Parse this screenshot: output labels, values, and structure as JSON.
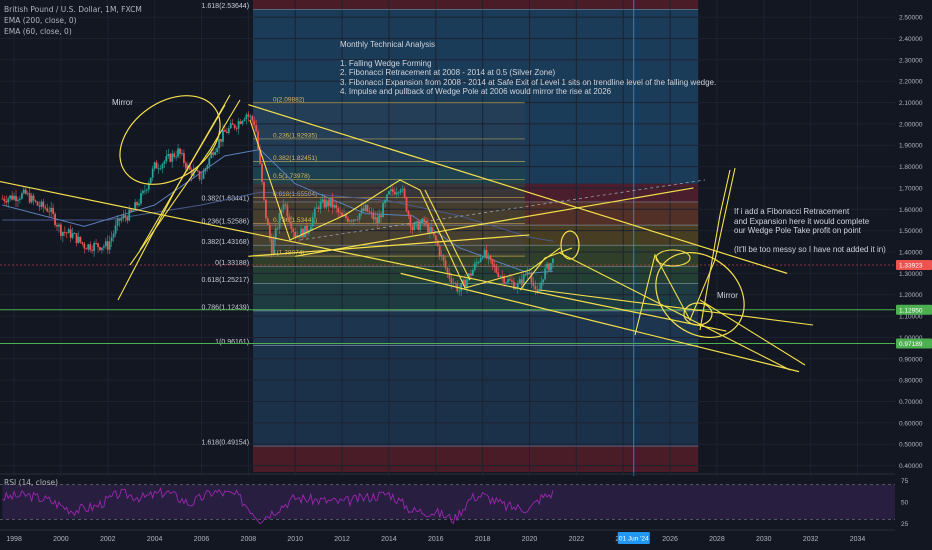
{
  "legend": {
    "symbol": "British Pound / U.S. Dollar, 1M, FXCM",
    "ema200": "EMA (200, close, 0)",
    "ema60": "EMA (60, close, 0)"
  },
  "analysis_text": {
    "title": "Monthly Technical Analysis",
    "points": [
      "1. Falling Wedge Forming",
      "2. Fibonacci Retracement at 2008 - 2014 at 0.5 (Silver Zone)",
      "3. Fibonacci Expansion from  2008 - 2014 at Safe Exit of Level 1 sits on trendline level of the falling wedge.",
      "4. Impulse and pullback of Wedge Pole at 2006 would mirror the rise at 2026"
    ]
  },
  "side_note": {
    "lines": [
      "If i add a Fibonacci Retracement",
      "and Expansion here it would complete",
      "our Wedge Pole Take profit on point",
      "",
      "(It'll be too messy so I have not added it in)"
    ]
  },
  "annotations": {
    "mirror_left": "Mirror",
    "mirror_right": "Mirror"
  },
  "colors": {
    "background": "#131722",
    "candle_up": "#26a69a",
    "candle_down": "#ef5350",
    "trendline": "#f5e04b",
    "green_line": "#4caf50",
    "current_price": "#ef5350",
    "date_marker": "#2196f3",
    "rsi_line": "#9c27b0"
  },
  "chart_data": {
    "type": "line",
    "symbol": "GBPUSD",
    "timeframe": "1M",
    "x_axis_years": [
      "1998",
      "2000",
      "2002",
      "2004",
      "2006",
      "2008",
      "2010",
      "2012",
      "2014",
      "2016",
      "2018",
      "2020",
      "2022",
      "2024",
      "2026",
      "2028",
      "2030",
      "2032",
      "2034"
    ],
    "x_range": [
      1997.4,
      2035.6
    ],
    "y_ticks": [
      0.4,
      0.5,
      0.6,
      0.7,
      0.8,
      0.9,
      1.0,
      1.1,
      1.2,
      1.3,
      1.4,
      1.5,
      1.6,
      1.7,
      1.8,
      1.9,
      2.0,
      2.1,
      2.2,
      2.3,
      2.4,
      2.5
    ],
    "y_tick_labels": [
      "0.40000",
      "0.50000",
      "0.60000",
      "0.70000",
      "0.80000",
      "0.90000",
      "1.00000",
      "1.10000",
      "1.20000",
      "1.30000",
      "1.40000",
      "1.50000",
      "1.60000",
      "1.70000",
      "1.80000",
      "1.90000",
      "2.00000",
      "2.10000",
      "2.20000",
      "2.30000",
      "2.40000",
      "2.50000"
    ],
    "ylim": [
      0.37,
      2.58
    ],
    "price_series": {
      "name": "British Pound / U.S. Dollar",
      "x": [
        1997.5,
        1998.0,
        1998.5,
        1999.0,
        1999.5,
        2000.0,
        2000.5,
        2001.0,
        2001.5,
        2002.0,
        2002.5,
        2003.0,
        2003.5,
        2004.0,
        2004.5,
        2005.0,
        2005.5,
        2006.0,
        2006.5,
        2007.0,
        2007.5,
        2007.9,
        2008.3,
        2008.7,
        2009.0,
        2009.5,
        2010.0,
        2010.5,
        2011.0,
        2011.5,
        2012.0,
        2012.5,
        2013.0,
        2013.5,
        2014.0,
        2014.5,
        2015.0,
        2015.5,
        2016.0,
        2016.5,
        2017.0,
        2017.5,
        2018.0,
        2018.5,
        2019.0,
        2019.5,
        2020.0,
        2020.3,
        2020.6,
        2021.0
      ],
      "y": [
        1.65,
        1.66,
        1.67,
        1.62,
        1.6,
        1.5,
        1.48,
        1.43,
        1.43,
        1.43,
        1.55,
        1.58,
        1.67,
        1.8,
        1.83,
        1.87,
        1.78,
        1.75,
        1.88,
        1.96,
        2.0,
        2.05,
        2.0,
        1.6,
        1.41,
        1.64,
        1.48,
        1.5,
        1.62,
        1.63,
        1.56,
        1.56,
        1.6,
        1.54,
        1.67,
        1.71,
        1.51,
        1.54,
        1.45,
        1.3,
        1.22,
        1.3,
        1.4,
        1.32,
        1.27,
        1.24,
        1.32,
        1.18,
        1.3,
        1.36
      ]
    },
    "current_price": {
      "value": 1.33923,
      "label": "1.33923"
    },
    "support_lines": [
      {
        "value": 1.1295,
        "label": "1.12950"
      },
      {
        "value": 0.97189,
        "label": "0.97189"
      }
    ],
    "fib_retracement": [
      {
        "label": "0(2.09882)",
        "value": 2.09882
      },
      {
        "label": "0.236(1.92935)",
        "value": 1.92935
      },
      {
        "label": "0.382(1.82451)",
        "value": 1.82451
      },
      {
        "label": "0.5(1.73978)",
        "value": 1.73978
      },
      {
        "label": "0.618(1.65504)",
        "value": 1.65504
      },
      {
        "label": "0.786(1.53441)",
        "value": 1.53441
      },
      {
        "label": "1(1.38074)",
        "value": 1.38074
      }
    ],
    "fib_expansion": [
      {
        "label": "1.618(2.53644)",
        "value": 2.53644
      },
      {
        "label": "0.382(1.63441)",
        "value": 1.63441
      },
      {
        "label": "0.236(1.52586)",
        "value": 1.52586
      },
      {
        "label": "0.382(1.43168)",
        "value": 1.43168
      },
      {
        "label": "0(1.33188)",
        "value": 1.33188
      },
      {
        "label": "0.618(1.25217)",
        "value": 1.25217
      },
      {
        "label": "0.786(1.12439)",
        "value": 1.12439
      },
      {
        "label": "1(0.96161)",
        "value": 0.96161
      },
      {
        "label": "1.618(0.49154)",
        "value": 0.49154
      }
    ],
    "fib_zone_x": [
      2008.2,
      2027.2
    ],
    "date_marker": {
      "x": 2024.45,
      "label": "01 Jun '24"
    },
    "ema200": {
      "name": "EMA (200, close, 0)",
      "x": [
        1997.5,
        2002,
        2006,
        2008.5,
        2011,
        2014,
        2017,
        2020,
        2021
      ],
      "y": [
        1.55,
        1.55,
        1.62,
        1.68,
        1.67,
        1.64,
        1.57,
        1.47,
        1.45
      ]
    },
    "ema60": {
      "name": "EMA (60, close, 0)",
      "x": [
        1997.5,
        2001,
        2004,
        2007,
        2008.5,
        2010,
        2013,
        2015,
        2017,
        2020,
        2021
      ],
      "y": [
        1.62,
        1.52,
        1.62,
        1.85,
        1.88,
        1.72,
        1.58,
        1.57,
        1.42,
        1.3,
        1.31
      ]
    },
    "trendlines": [
      {
        "x": [
          1997.4,
          2028.4
        ],
        "y": [
          1.73,
          1.03
        ]
      },
      {
        "x": [
          2008.0,
          2031.0
        ],
        "y": [
          2.09,
          1.3
        ]
      },
      {
        "x": [
          2014.5,
          2031.5
        ],
        "y": [
          1.3,
          0.84
        ]
      },
      {
        "x": [
          2010.0,
          2027.0
        ],
        "y": [
          1.38,
          1.7
        ]
      },
      {
        "x": [
          2008.0,
          2020.0
        ],
        "y": [
          1.38,
          1.48
        ]
      }
    ],
    "rsi": {
      "name": "RSI (14, close)",
      "yticks": [
        25,
        50,
        75
      ],
      "bands": [
        30,
        70
      ],
      "x": [
        1997.5,
        1998.5,
        1999.5,
        2000.5,
        2001.5,
        2002.5,
        2003.5,
        2004.5,
        2005.5,
        2006.5,
        2007.5,
        2008.5,
        2009.0,
        2010.0,
        2011.0,
        2012.0,
        2013.0,
        2014.0,
        2015.0,
        2016.0,
        2016.8,
        2017.5,
        2018.0,
        2019.0,
        2020.0,
        2020.5,
        2021.0
      ],
      "y": [
        55,
        58,
        52,
        40,
        45,
        60,
        55,
        62,
        48,
        62,
        58,
        30,
        38,
        55,
        52,
        50,
        55,
        60,
        40,
        38,
        30,
        55,
        58,
        45,
        42,
        55,
        60
      ]
    }
  }
}
